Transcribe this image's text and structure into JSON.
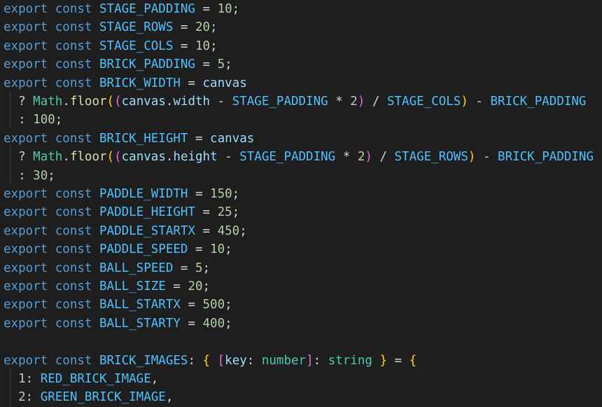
{
  "editor": {
    "lines": [
      [
        {
          "t": "export",
          "c": "t-kw"
        },
        {
          "t": " "
        },
        {
          "t": "const",
          "c": "t-kw"
        },
        {
          "t": " "
        },
        {
          "t": "STAGE_PADDING",
          "c": "t-const"
        },
        {
          "t": " = ",
          "c": "t-op"
        },
        {
          "t": "10",
          "c": "t-num"
        },
        {
          "t": ";",
          "c": "t-op"
        }
      ],
      [
        {
          "t": "export",
          "c": "t-kw"
        },
        {
          "t": " "
        },
        {
          "t": "const",
          "c": "t-kw"
        },
        {
          "t": " "
        },
        {
          "t": "STAGE_ROWS",
          "c": "t-const"
        },
        {
          "t": " = ",
          "c": "t-op"
        },
        {
          "t": "20",
          "c": "t-num"
        },
        {
          "t": ";",
          "c": "t-op"
        }
      ],
      [
        {
          "t": "export",
          "c": "t-kw"
        },
        {
          "t": " "
        },
        {
          "t": "const",
          "c": "t-kw"
        },
        {
          "t": " "
        },
        {
          "t": "STAGE_COLS",
          "c": "t-const"
        },
        {
          "t": " = ",
          "c": "t-op"
        },
        {
          "t": "10",
          "c": "t-num"
        },
        {
          "t": ";",
          "c": "t-op"
        }
      ],
      [
        {
          "t": "export",
          "c": "t-kw"
        },
        {
          "t": " "
        },
        {
          "t": "const",
          "c": "t-kw"
        },
        {
          "t": " "
        },
        {
          "t": "BRICK_PADDING",
          "c": "t-const"
        },
        {
          "t": " = ",
          "c": "t-op"
        },
        {
          "t": "5",
          "c": "t-num"
        },
        {
          "t": ";",
          "c": "t-op"
        }
      ],
      [
        {
          "t": "export",
          "c": "t-kw"
        },
        {
          "t": " "
        },
        {
          "t": "const",
          "c": "t-kw"
        },
        {
          "t": " "
        },
        {
          "t": "BRICK_WIDTH",
          "c": "t-const"
        },
        {
          "t": " = ",
          "c": "t-op"
        },
        {
          "t": "canvas",
          "c": "t-var"
        }
      ],
      [
        {
          "t": "  ? "
        },
        {
          "t": "Math",
          "c": "t-type"
        },
        {
          "t": "."
        },
        {
          "t": "floor",
          "c": "t-fn"
        },
        {
          "t": "(",
          "c": "b1"
        },
        {
          "t": "(",
          "c": "b2"
        },
        {
          "t": "canvas",
          "c": "t-var"
        },
        {
          "t": "."
        },
        {
          "t": "width",
          "c": "t-var"
        },
        {
          "t": " - "
        },
        {
          "t": "STAGE_PADDING",
          "c": "t-const"
        },
        {
          "t": " * "
        },
        {
          "t": "2",
          "c": "t-num"
        },
        {
          "t": ")",
          "c": "b2"
        },
        {
          "t": " / "
        },
        {
          "t": "STAGE_COLS",
          "c": "t-const"
        },
        {
          "t": ")",
          "c": "b1"
        },
        {
          "t": " - "
        },
        {
          "t": "BRICK_PADDING",
          "c": "t-const"
        }
      ],
      [
        {
          "t": "  : "
        },
        {
          "t": "100",
          "c": "t-num"
        },
        {
          "t": ";"
        }
      ],
      [
        {
          "t": "export",
          "c": "t-kw"
        },
        {
          "t": " "
        },
        {
          "t": "const",
          "c": "t-kw"
        },
        {
          "t": " "
        },
        {
          "t": "BRICK_HEIGHT",
          "c": "t-const"
        },
        {
          "t": " = ",
          "c": "t-op"
        },
        {
          "t": "canvas",
          "c": "t-var"
        }
      ],
      [
        {
          "t": "  ? "
        },
        {
          "t": "Math",
          "c": "t-type"
        },
        {
          "t": "."
        },
        {
          "t": "floor",
          "c": "t-fn"
        },
        {
          "t": "(",
          "c": "b1"
        },
        {
          "t": "(",
          "c": "b2"
        },
        {
          "t": "canvas",
          "c": "t-var"
        },
        {
          "t": "."
        },
        {
          "t": "height",
          "c": "t-var"
        },
        {
          "t": " - "
        },
        {
          "t": "STAGE_PADDING",
          "c": "t-const"
        },
        {
          "t": " * "
        },
        {
          "t": "2",
          "c": "t-num"
        },
        {
          "t": ")",
          "c": "b2"
        },
        {
          "t": " / "
        },
        {
          "t": "STAGE_ROWS",
          "c": "t-const"
        },
        {
          "t": ")",
          "c": "b1"
        },
        {
          "t": " - "
        },
        {
          "t": "BRICK_PADDING",
          "c": "t-const"
        }
      ],
      [
        {
          "t": "  : "
        },
        {
          "t": "30",
          "c": "t-num"
        },
        {
          "t": ";"
        }
      ],
      [
        {
          "t": "export",
          "c": "t-kw"
        },
        {
          "t": " "
        },
        {
          "t": "const",
          "c": "t-kw"
        },
        {
          "t": " "
        },
        {
          "t": "PADDLE_WIDTH",
          "c": "t-const"
        },
        {
          "t": " = ",
          "c": "t-op"
        },
        {
          "t": "150",
          "c": "t-num"
        },
        {
          "t": ";",
          "c": "t-op"
        }
      ],
      [
        {
          "t": "export",
          "c": "t-kw"
        },
        {
          "t": " "
        },
        {
          "t": "const",
          "c": "t-kw"
        },
        {
          "t": " "
        },
        {
          "t": "PADDLE_HEIGHT",
          "c": "t-const"
        },
        {
          "t": " = ",
          "c": "t-op"
        },
        {
          "t": "25",
          "c": "t-num"
        },
        {
          "t": ";",
          "c": "t-op"
        }
      ],
      [
        {
          "t": "export",
          "c": "t-kw"
        },
        {
          "t": " "
        },
        {
          "t": "const",
          "c": "t-kw"
        },
        {
          "t": " "
        },
        {
          "t": "PADDLE_STARTX",
          "c": "t-const"
        },
        {
          "t": " = ",
          "c": "t-op"
        },
        {
          "t": "450",
          "c": "t-num"
        },
        {
          "t": ";",
          "c": "t-op"
        }
      ],
      [
        {
          "t": "export",
          "c": "t-kw"
        },
        {
          "t": " "
        },
        {
          "t": "const",
          "c": "t-kw"
        },
        {
          "t": " "
        },
        {
          "t": "PADDLE_SPEED",
          "c": "t-const"
        },
        {
          "t": " = ",
          "c": "t-op"
        },
        {
          "t": "10",
          "c": "t-num"
        },
        {
          "t": ";",
          "c": "t-op"
        }
      ],
      [
        {
          "t": "export",
          "c": "t-kw"
        },
        {
          "t": " "
        },
        {
          "t": "const",
          "c": "t-kw"
        },
        {
          "t": " "
        },
        {
          "t": "BALL_SPEED",
          "c": "t-const"
        },
        {
          "t": " = ",
          "c": "t-op"
        },
        {
          "t": "5",
          "c": "t-num"
        },
        {
          "t": ";",
          "c": "t-op"
        }
      ],
      [
        {
          "t": "export",
          "c": "t-kw"
        },
        {
          "t": " "
        },
        {
          "t": "const",
          "c": "t-kw"
        },
        {
          "t": " "
        },
        {
          "t": "BALL_SIZE",
          "c": "t-const"
        },
        {
          "t": " = ",
          "c": "t-op"
        },
        {
          "t": "20",
          "c": "t-num"
        },
        {
          "t": ";",
          "c": "t-op"
        }
      ],
      [
        {
          "t": "export",
          "c": "t-kw"
        },
        {
          "t": " "
        },
        {
          "t": "const",
          "c": "t-kw"
        },
        {
          "t": " "
        },
        {
          "t": "BALL_STARTX",
          "c": "t-const"
        },
        {
          "t": " = ",
          "c": "t-op"
        },
        {
          "t": "500",
          "c": "t-num"
        },
        {
          "t": ";",
          "c": "t-op"
        }
      ],
      [
        {
          "t": "export",
          "c": "t-kw"
        },
        {
          "t": " "
        },
        {
          "t": "const",
          "c": "t-kw"
        },
        {
          "t": " "
        },
        {
          "t": "BALL_STARTY",
          "c": "t-const"
        },
        {
          "t": " = ",
          "c": "t-op"
        },
        {
          "t": "400",
          "c": "t-num"
        },
        {
          "t": ";",
          "c": "t-op"
        }
      ],
      [],
      [
        {
          "t": "export",
          "c": "t-kw"
        },
        {
          "t": " "
        },
        {
          "t": "const",
          "c": "t-kw"
        },
        {
          "t": " "
        },
        {
          "t": "BRICK_IMAGES",
          "c": "t-const"
        },
        {
          "t": ": "
        },
        {
          "t": "{",
          "c": "b1"
        },
        {
          "t": " "
        },
        {
          "t": "[",
          "c": "b2"
        },
        {
          "t": "key",
          "c": "t-var"
        },
        {
          "t": ": "
        },
        {
          "t": "number",
          "c": "t-type"
        },
        {
          "t": "]",
          "c": "b2"
        },
        {
          "t": ": "
        },
        {
          "t": "string",
          "c": "t-type"
        },
        {
          "t": " "
        },
        {
          "t": "}",
          "c": "b1"
        },
        {
          "t": " = "
        },
        {
          "t": "{",
          "c": "b1"
        }
      ],
      [
        {
          "t": "  "
        },
        {
          "t": "1",
          "c": "t-num"
        },
        {
          "t": ": "
        },
        {
          "t": "RED_BRICK_IMAGE",
          "c": "t-const"
        },
        {
          "t": ","
        }
      ],
      [
        {
          "t": "  "
        },
        {
          "t": "2",
          "c": "t-num"
        },
        {
          "t": ": "
        },
        {
          "t": "GREEN_BRICK_IMAGE",
          "c": "t-const"
        },
        {
          "t": ","
        }
      ]
    ]
  }
}
